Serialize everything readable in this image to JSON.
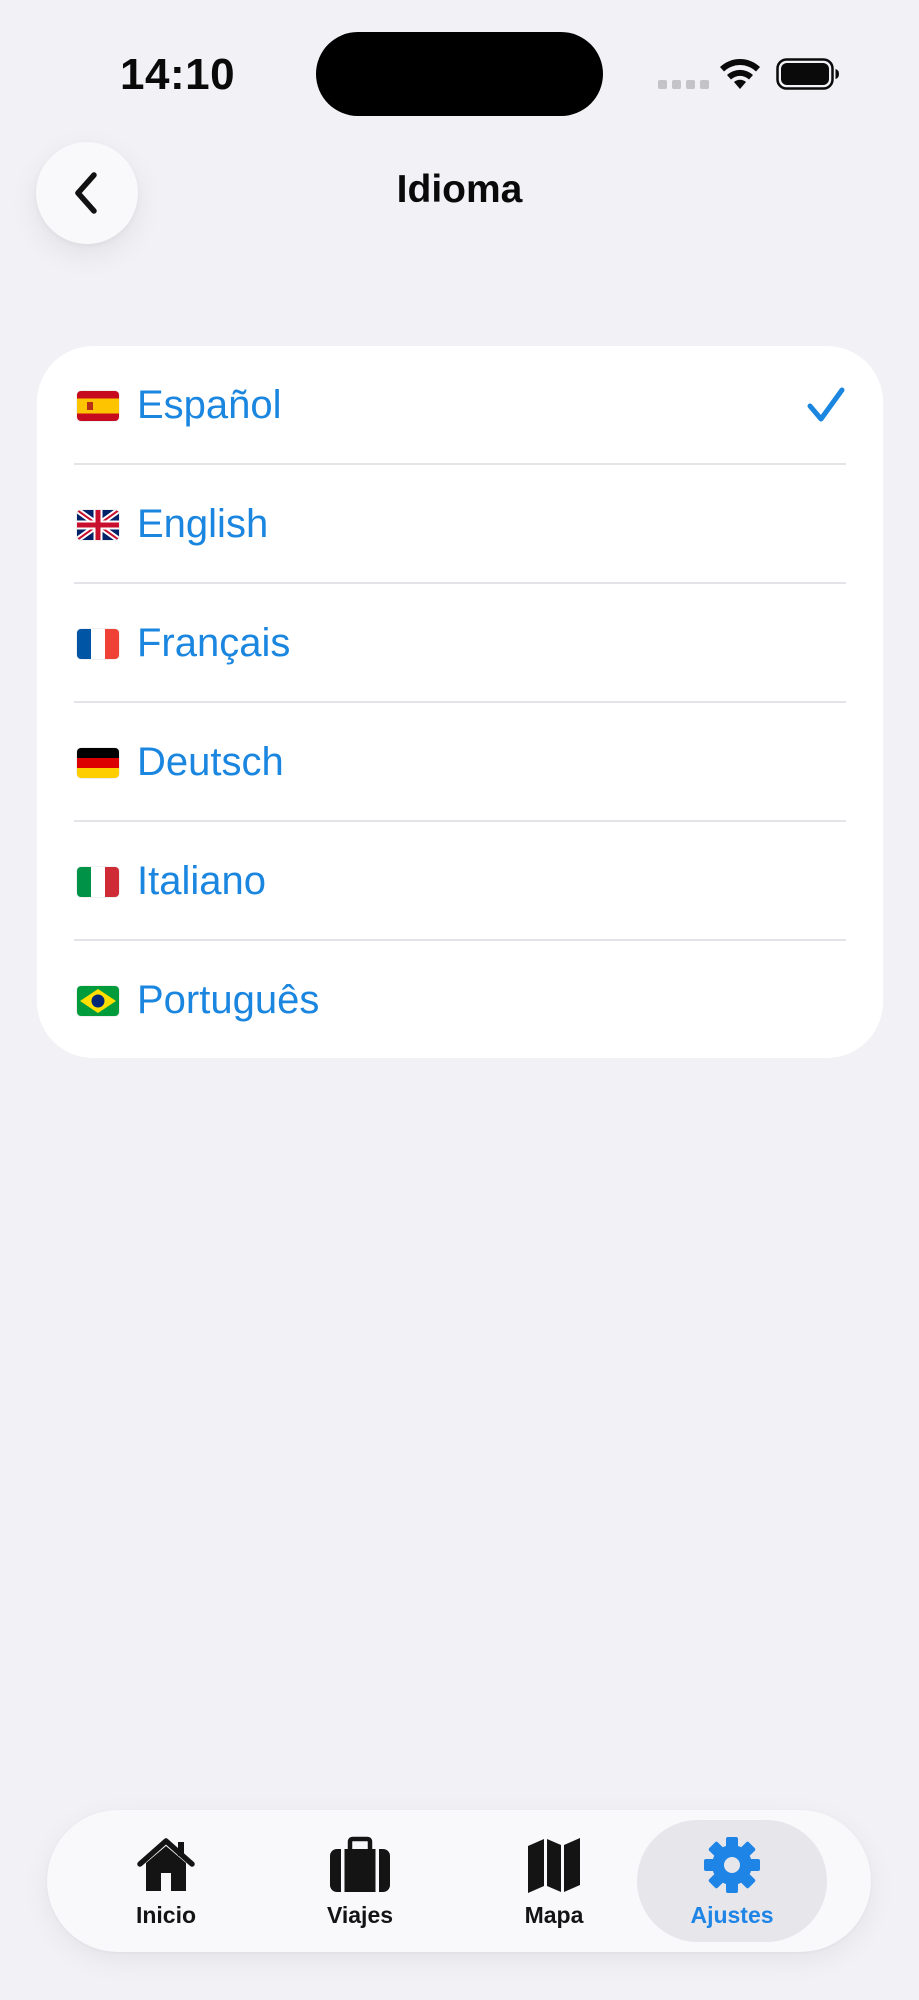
{
  "status_bar": {
    "time": "14:10"
  },
  "header": {
    "back_icon": "chevron-left-icon",
    "title": "Idioma"
  },
  "languages": [
    {
      "flag": "spain-flag-icon",
      "label": "Español",
      "selected": true
    },
    {
      "flag": "uk-flag-icon",
      "label": "English",
      "selected": false
    },
    {
      "flag": "france-flag-icon",
      "label": "Français",
      "selected": false
    },
    {
      "flag": "germany-flag-icon",
      "label": "Deutsch",
      "selected": false
    },
    {
      "flag": "italy-flag-icon",
      "label": "Italiano",
      "selected": false
    },
    {
      "flag": "brazil-flag-icon",
      "label": "Português",
      "selected": false
    }
  ],
  "tabs": [
    {
      "icon": "house-icon",
      "label": "Inicio",
      "active": false
    },
    {
      "icon": "suitcase-icon",
      "label": "Viajes",
      "active": false
    },
    {
      "icon": "map-icon",
      "label": "Mapa",
      "active": false
    },
    {
      "icon": "gear-icon",
      "label": "Ajustes",
      "active": true
    }
  ],
  "colors": {
    "accent": "#1a86e0",
    "background": "#f1f1f6",
    "card": "#ffffff"
  }
}
